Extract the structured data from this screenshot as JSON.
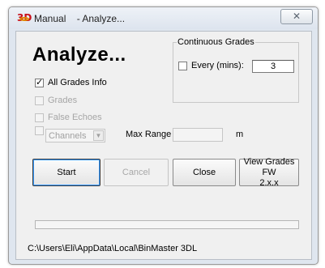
{
  "window": {
    "title": "Manual    - Analyze...",
    "close_symbol": "✕",
    "app_icon": "binmaster-3d-app-icon"
  },
  "main": {
    "heading": "Analyze...",
    "all_grades_info": {
      "label": "All Grades Info",
      "checked": true,
      "enabled": true
    },
    "grades": {
      "label": "Grades",
      "checked": false,
      "enabled": false
    },
    "false_echoes": {
      "label": "False Echoes",
      "checked": false,
      "enabled": false
    },
    "channels": {
      "selected": "Channels",
      "checked": false,
      "enabled": false
    },
    "max_range": {
      "label": "Max Range :",
      "value": "",
      "unit": "m"
    }
  },
  "continuous_grades": {
    "group_label": "Continuous Grades",
    "every_label": "Every (mins):",
    "every_checked": false,
    "minutes_value": "3"
  },
  "buttons": {
    "start": "Start",
    "cancel": "Cancel",
    "close": "Close",
    "view_grades_line1": "View Grades FW",
    "view_grades_line2": "2.x.x"
  },
  "progress": {
    "value": 0
  },
  "status": {
    "path": "C:\\Users\\Eli\\AppData\\Local\\BinMaster 3DL"
  },
  "colors": {
    "accent_icon": "#c8101a",
    "dialog_bg": "#f0f0f0",
    "frame": "#dfe6ef"
  }
}
